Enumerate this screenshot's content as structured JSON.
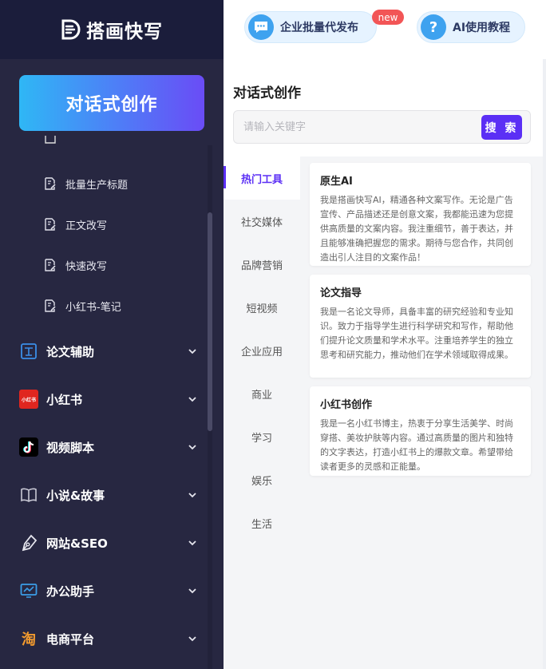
{
  "brand": {
    "name": "搭画快写"
  },
  "sidebar": {
    "main_button": "对话式创作",
    "sub_items": [
      {
        "label": "批量生产标题"
      },
      {
        "label": "正文改写"
      },
      {
        "label": "快速改写"
      },
      {
        "label": "小红书-笔记"
      }
    ],
    "menu": [
      {
        "label": "论文辅助",
        "icon": "paper-icon"
      },
      {
        "label": "小红书",
        "icon": "xiaohongshu-logo-icon",
        "logo_text": "小红书"
      },
      {
        "label": "视频脚本",
        "icon": "tiktok-icon"
      },
      {
        "label": "小说&故事",
        "icon": "book-icon"
      },
      {
        "label": "网站&SEO",
        "icon": "pen-icon"
      },
      {
        "label": "办公助手",
        "icon": "monitor-icon"
      },
      {
        "label": "电商平台",
        "icon": "taobao-icon",
        "logo_text": "淘"
      }
    ]
  },
  "topbar": {
    "pill1": {
      "label": "企业批量代发布",
      "badge": "new"
    },
    "pill2": {
      "label": "AI使用教程",
      "icon_char": "?"
    }
  },
  "main": {
    "title": "对话式创作",
    "search": {
      "placeholder": "请输入关键字",
      "button": "搜 索"
    },
    "tabs": [
      {
        "label": "热门工具",
        "active": true
      },
      {
        "label": "社交媒体"
      },
      {
        "label": "品牌营销"
      },
      {
        "label": "短视频"
      },
      {
        "label": "企业应用"
      },
      {
        "label": "商业"
      },
      {
        "label": "学习"
      },
      {
        "label": "娱乐"
      },
      {
        "label": "生活"
      }
    ],
    "cards": [
      {
        "title": "原生AI",
        "desc": "我是搭画快写AI，精通各种文案写作。无论是广告宣传、产品描述还是创意文案，我都能迅速为您提供高质量的文案内容。我注重细节，善于表达，并且能够准确把握您的需求。期待与您合作，共同创造出引人注目的文案作品！"
      },
      {
        "title": "论文指导",
        "desc": "我是一名论文导师，具备丰富的研究经验和专业知识。致力于指导学生进行科学研究和写作，帮助他们提升论文质量和学术水平。注重培养学生的独立思考和研究能力，推动他们在学术领域取得成果。"
      },
      {
        "title": "小红书创作",
        "desc": "我是一名小红书博主，热衷于分享生活美学、时尚穿搭、美妆护肤等内容。通过高质量的图片和独特的文字表达，打造小红书上的爆款文章。希望带给读者更多的灵感和正能量。"
      }
    ]
  }
}
